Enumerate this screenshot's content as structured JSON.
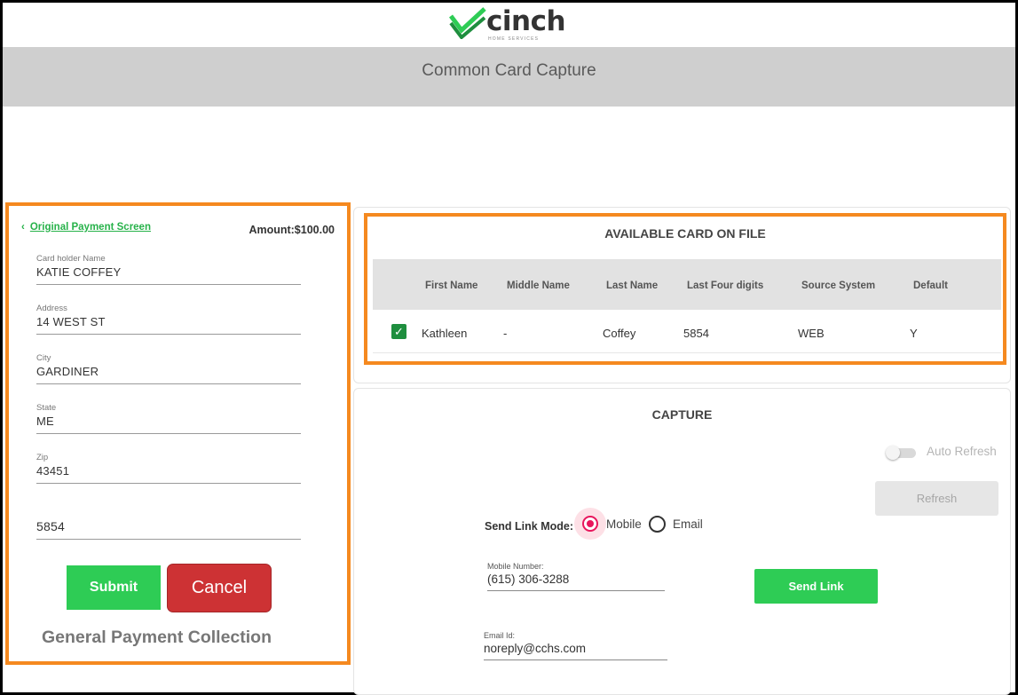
{
  "brand": {
    "name": "cinch",
    "subtitle": "HOME SERVICES",
    "accent_color": "#2ecc55",
    "highlight_color": "#f5891f"
  },
  "header": {
    "title": "Common Card Capture"
  },
  "left_panel": {
    "back_link": "Original Payment Screen",
    "back_icon": "chevron-left-icon",
    "amount": "Amount:$100.00",
    "fields": [
      {
        "label": "Card holder Name",
        "value": "KATIE COFFEY"
      },
      {
        "label": "Address",
        "value": "14 WEST ST"
      },
      {
        "label": "City",
        "value": "GARDINER"
      },
      {
        "label": "State",
        "value": "ME"
      },
      {
        "label": "Zip",
        "value": "43451"
      },
      {
        "label": "",
        "value": "5854"
      }
    ],
    "submit_label": "Submit",
    "cancel_label": "Cancel",
    "footer_label": "General Payment Collection"
  },
  "card_on_file": {
    "title": "AVAILABLE CARD ON FILE",
    "columns": [
      "First Name",
      "Middle Name",
      "Last Name",
      "Last Four digits",
      "Source System",
      "Default"
    ],
    "rows": [
      {
        "selected": true,
        "first_name": "Kathleen",
        "middle_name": "-",
        "last_name": "Coffey",
        "last_four": "5854",
        "source": "WEB",
        "default": "Y"
      }
    ]
  },
  "capture": {
    "title": "CAPTURE",
    "auto_refresh_label": "Auto Refresh",
    "auto_refresh_on": false,
    "refresh_label": "Refresh",
    "send_link_mode_label": "Send Link Mode:",
    "mode_options": [
      {
        "label": "Mobile",
        "selected": true
      },
      {
        "label": "Email",
        "selected": false
      }
    ],
    "mobile_label": "Mobile Number:",
    "mobile_value": "(615) 306-3288",
    "send_link_label": "Send Link",
    "email_label": "Email Id:",
    "email_value": "noreply@cchs.com"
  }
}
